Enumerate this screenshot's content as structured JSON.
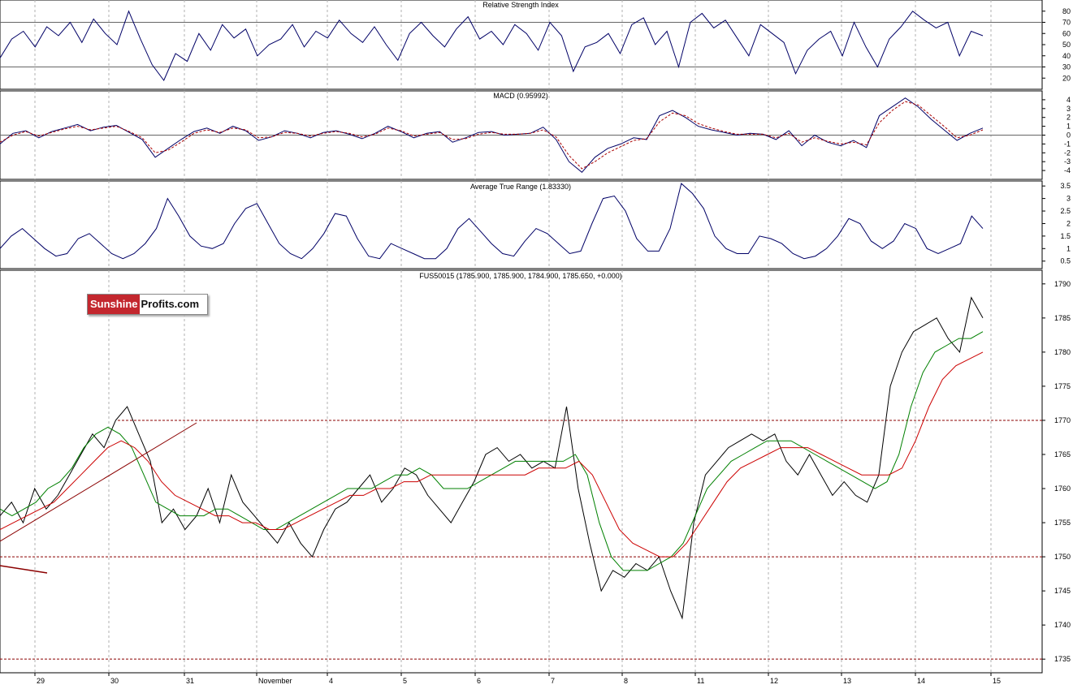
{
  "logo": {
    "part1": "Sunshine",
    "part2": "Profits.com"
  },
  "x_axis": {
    "labels": [
      "29",
      "30",
      "31",
      "November",
      "4",
      "5",
      "6",
      "7",
      "8",
      "11",
      "12",
      "13",
      "14",
      "15"
    ]
  },
  "chart_data": [
    {
      "type": "line",
      "title": "Relative Strength Index",
      "ylim": [
        10,
        90
      ],
      "yticks": [
        80,
        70,
        60,
        50,
        40,
        30,
        20
      ],
      "reference_lines": [
        70,
        30
      ],
      "series": [
        {
          "values": [
            38,
            55,
            62,
            48,
            66,
            58,
            70,
            52,
            73,
            60,
            50,
            80,
            55,
            32,
            18,
            42,
            35,
            60,
            45,
            68,
            56,
            64,
            40,
            50,
            55,
            68,
            48,
            62,
            56,
            72,
            60,
            52,
            66,
            50,
            36,
            60,
            70,
            58,
            48,
            64,
            75,
            55,
            62,
            50,
            68,
            60,
            45,
            70,
            58,
            26,
            48,
            52,
            60,
            42,
            68,
            74,
            50,
            62,
            30,
            70,
            78,
            65,
            72,
            56,
            40,
            68,
            60,
            52,
            24,
            45,
            55,
            62,
            40,
            70,
            48,
            30,
            55,
            66,
            80,
            72,
            65,
            70,
            40,
            62,
            58
          ]
        },
        {
          "values": []
        }
      ],
      "line_color": "#000066",
      "grid": true
    },
    {
      "type": "line",
      "title": "MACD (0.95992)",
      "ylim": [
        -5,
        5
      ],
      "yticks": [
        4,
        3,
        2,
        1,
        0,
        -1,
        -2,
        -3,
        -4
      ],
      "reference_lines": [
        0
      ],
      "series": [
        {
          "name": "",
          "color": "#000066",
          "values": [
            -1.0,
            0.2,
            0.5,
            -0.3,
            0.4,
            0.8,
            1.2,
            0.5,
            0.9,
            1.1,
            0.3,
            -0.5,
            -2.5,
            -1.5,
            -0.5,
            0.4,
            0.8,
            0.2,
            1.0,
            0.5,
            -0.6,
            -0.2,
            0.5,
            0.2,
            -0.3,
            0.3,
            0.5,
            0.1,
            -0.4,
            0.2,
            1.0,
            0.4,
            -0.3,
            0.2,
            0.4,
            -0.8,
            -0.3,
            0.3,
            0.4,
            0.0,
            0.1,
            0.2,
            0.9,
            -0.5,
            -3.0,
            -4.2,
            -2.5,
            -1.5,
            -1.0,
            -0.3,
            -0.5,
            2.2,
            2.8,
            2.0,
            1.0,
            0.6,
            0.3,
            0.0,
            0.2,
            0.1,
            -0.5,
            0.5,
            -1.2,
            0.0,
            -0.8,
            -1.2,
            -0.6,
            -1.4,
            2.2,
            3.2,
            4.2,
            3.2,
            1.8,
            0.6,
            -0.6,
            0.2,
            0.8
          ]
        },
        {
          "name": "",
          "color": "#aa0000",
          "dashed": true,
          "values": [
            -0.8,
            0.0,
            0.4,
            -0.1,
            0.3,
            0.7,
            1.0,
            0.6,
            0.8,
            1.0,
            0.4,
            -0.3,
            -2.0,
            -1.7,
            -0.8,
            0.2,
            0.6,
            0.3,
            0.8,
            0.6,
            -0.3,
            -0.2,
            0.3,
            0.2,
            -0.1,
            0.2,
            0.4,
            0.2,
            -0.2,
            0.1,
            0.8,
            0.5,
            -0.1,
            0.1,
            0.3,
            -0.5,
            -0.4,
            0.1,
            0.3,
            0.1,
            0.1,
            0.2,
            0.6,
            -0.2,
            -2.3,
            -3.8,
            -3.0,
            -2.0,
            -1.3,
            -0.6,
            -0.4,
            1.5,
            2.5,
            2.2,
            1.3,
            0.8,
            0.4,
            0.1,
            0.1,
            0.1,
            -0.3,
            0.2,
            -0.8,
            -0.3,
            -0.7,
            -1.0,
            -0.8,
            -1.1,
            1.4,
            2.8,
            3.8,
            3.4,
            2.2,
            1.0,
            -0.3,
            0.0,
            0.6
          ]
        }
      ],
      "grid": true
    },
    {
      "type": "line",
      "title": "Average True Range (1.83330)",
      "ylim": [
        0.2,
        3.7
      ],
      "yticks": [
        3.5,
        3.0,
        2.5,
        2.0,
        1.5,
        1.0,
        0.5
      ],
      "series": [
        {
          "color": "#000066",
          "values": [
            1.0,
            1.5,
            1.8,
            1.4,
            1.0,
            0.7,
            0.8,
            1.4,
            1.6,
            1.2,
            0.8,
            0.6,
            0.8,
            1.2,
            1.8,
            3.0,
            2.3,
            1.5,
            1.1,
            1.0,
            1.2,
            2.0,
            2.6,
            2.8,
            2.0,
            1.2,
            0.8,
            0.6,
            1.0,
            1.6,
            2.4,
            2.3,
            1.4,
            0.7,
            0.6,
            1.2,
            1.0,
            0.8,
            0.6,
            0.6,
            1.0,
            1.8,
            2.2,
            1.7,
            1.2,
            0.8,
            0.7,
            1.3,
            1.8,
            1.6,
            1.2,
            0.8,
            0.9,
            2.0,
            3.0,
            3.1,
            2.5,
            1.4,
            0.9,
            0.9,
            1.8,
            3.6,
            3.2,
            2.6,
            1.5,
            1.0,
            0.8,
            0.8,
            1.5,
            1.4,
            1.2,
            0.8,
            0.6,
            0.7,
            1.0,
            1.5,
            2.2,
            2.0,
            1.3,
            1.0,
            1.3,
            2.0,
            1.8,
            1.0,
            0.8,
            1.0,
            1.2,
            2.3,
            1.8
          ]
        }
      ],
      "grid": true
    },
    {
      "type": "line",
      "title": "FUS50015 (1785.900, 1785.900, 1784.900, 1785.650, +0.000)",
      "ylim": [
        1733,
        1792
      ],
      "yticks": [
        1790,
        1785,
        1780,
        1775,
        1770,
        1765,
        1760,
        1755,
        1750,
        1745,
        1740,
        1735
      ],
      "horizontal_lines": [
        1770,
        1750,
        1735
      ],
      "series": [
        {
          "name": "",
          "color": "#000000",
          "values": [
            1756,
            1758,
            1755,
            1760,
            1757,
            1759,
            1762,
            1765,
            1768,
            1766,
            1770,
            1772,
            1768,
            1764,
            1755,
            1757,
            1754,
            1756,
            1760,
            1755,
            1762,
            1758,
            1756,
            1754,
            1752,
            1755,
            1752,
            1750,
            1754,
            1757,
            1758,
            1760,
            1762,
            1758,
            1760,
            1763,
            1762,
            1759,
            1757,
            1755,
            1758,
            1761,
            1765,
            1766,
            1764,
            1765,
            1763,
            1764,
            1763,
            1772,
            1760,
            1752,
            1745,
            1748,
            1747,
            1749,
            1748,
            1750,
            1745,
            1741,
            1755,
            1762,
            1764,
            1766,
            1767,
            1768,
            1767,
            1768,
            1764,
            1762,
            1765,
            1762,
            1759,
            1761,
            1759,
            1758,
            1762,
            1775,
            1780,
            1783,
            1784,
            1785,
            1782,
            1780,
            1788,
            1785
          ]
        },
        {
          "name": "",
          "color": "#008000",
          "values": [
            1757,
            1756,
            1757,
            1758,
            1760,
            1761,
            1763,
            1766,
            1768,
            1769,
            1768,
            1766,
            1762,
            1758,
            1757,
            1756,
            1756,
            1756,
            1757,
            1757,
            1756,
            1755,
            1754,
            1754,
            1755,
            1756,
            1757,
            1758,
            1759,
            1760,
            1760,
            1760,
            1761,
            1762,
            1762,
            1763,
            1762,
            1760,
            1760,
            1760,
            1761,
            1762,
            1763,
            1764,
            1764,
            1764,
            1764,
            1764,
            1765,
            1762,
            1755,
            1750,
            1748,
            1748,
            1748,
            1749,
            1750,
            1752,
            1756,
            1760,
            1762,
            1764,
            1765,
            1766,
            1767,
            1767,
            1767,
            1766,
            1765,
            1764,
            1763,
            1762,
            1761,
            1760,
            1761,
            1765,
            1772,
            1777,
            1780,
            1781,
            1782,
            1782,
            1783
          ]
        },
        {
          "name": "",
          "color": "#cc0000",
          "values": [
            1754,
            1755,
            1756,
            1757,
            1758,
            1760,
            1762,
            1764,
            1766,
            1767,
            1766,
            1764,
            1761,
            1759,
            1758,
            1757,
            1756,
            1756,
            1755,
            1755,
            1754,
            1754,
            1755,
            1756,
            1757,
            1758,
            1759,
            1759,
            1760,
            1760,
            1761,
            1761,
            1762,
            1762,
            1762,
            1762,
            1762,
            1762,
            1762,
            1762,
            1763,
            1763,
            1763,
            1764,
            1762,
            1758,
            1754,
            1752,
            1751,
            1750,
            1750,
            1752,
            1755,
            1758,
            1761,
            1763,
            1764,
            1765,
            1766,
            1766,
            1766,
            1765,
            1764,
            1763,
            1762,
            1762,
            1762,
            1763,
            1767,
            1772,
            1776,
            1778,
            1779,
            1780
          ]
        }
      ],
      "grid": true
    }
  ]
}
